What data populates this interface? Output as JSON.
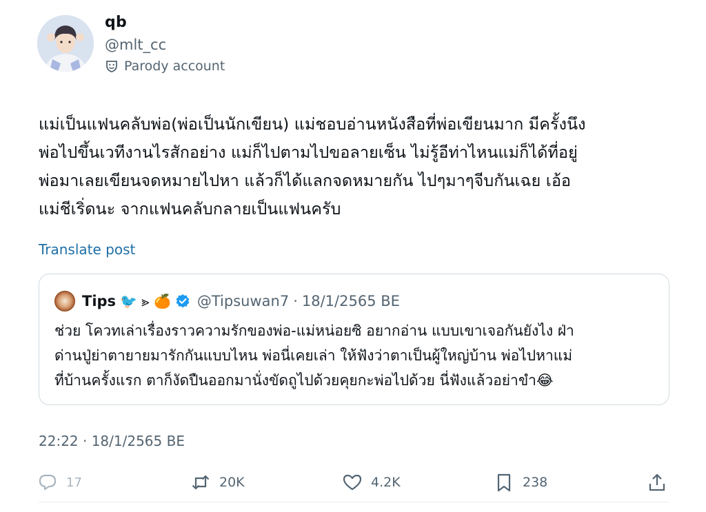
{
  "author": {
    "display_name": "qb",
    "handle": "@mlt_cc",
    "label": "Parody account"
  },
  "post": {
    "text": "แม่เป็นแฟนคลับพ่อ(พ่อเป็นนักเขียน) แม่ชอบอ่านหนังสือที่พ่อเขียนมาก มีครั้งนึง\nพ่อไปขึ้นเวทีงานไรสักอย่าง แม่ก็ไปตามไปขอลายเซ็น ไม่รู้อีท่าไหนแม่ก็ได้ที่อยู่\nพ่อมาเลยเขียนจดหมายไปหา แล้วก็ได้แลกจดหมายกัน ไปๆมาๆจีบกันเฉย เอ้อ\nแม่ชีเริ่ดนะ จากแฟนคลับกลายเป็นแฟนครับ",
    "translate_label": "Translate post",
    "timestamp": "22:22 · 18/1/2565 BE"
  },
  "quote": {
    "name": "Tips",
    "name_extra": "🐦 ⪢ 🍊",
    "handle": "@Tipsuwan7",
    "separator": "·",
    "date": "18/1/2565 BE",
    "text": "ช่วย โควทเล่าเรื่องราวความรักของพ่อ-แม่หน่อยซิ อยากอ่าน แบบเขาเจอกันยังไง ฝ่า\nด่านปู่ย่าตายายมารักกันแบบไหน พ่อนี่เคยเล่า ให้ฟังว่าตาเป็นผู้ใหญ่บ้าน พ่อไปหาแม่\nที่บ้านครั้งแรก ตาก็งัดปืนออกมานั่งขัดถูไปด้วยคุยกะพ่อไปด้วย นี่ฟังแล้วอย่าขำ😂"
  },
  "actions": {
    "reply_count": "17",
    "repost_count": "20K",
    "like_count": "4.2K",
    "bookmark_count": "238"
  },
  "icons": {
    "parody": "parody-mask-icon",
    "verified": "verified-badge-icon",
    "reply": "reply-icon",
    "repost": "repost-icon",
    "like": "heart-icon",
    "bookmark": "bookmark-icon",
    "share": "share-icon"
  },
  "colors": {
    "text_primary": "#0f1419",
    "text_secondary": "#536471",
    "link": "#1d6fa5",
    "verified": "#1d9bf0",
    "border": "#cfd9de"
  }
}
